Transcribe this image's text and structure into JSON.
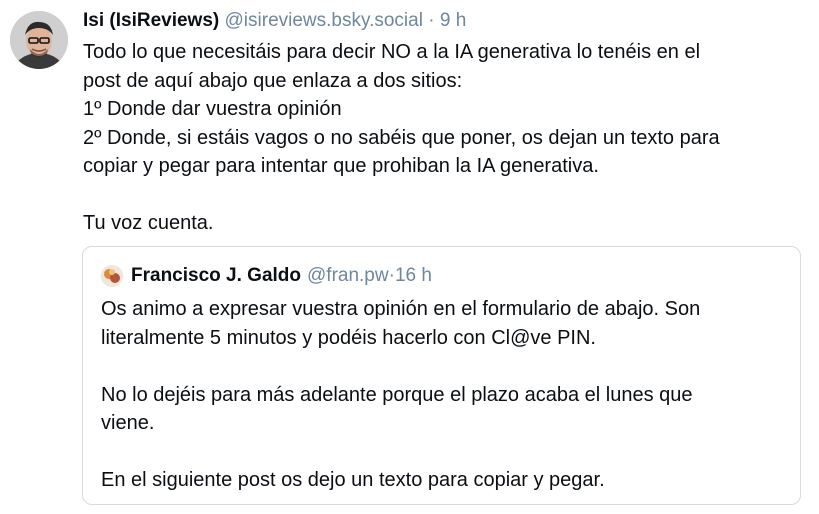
{
  "post": {
    "author_name": "Isi (IsiReviews)",
    "author_handle": "@isireviews.bsky.social",
    "separator": "·",
    "time_ago": "9 h",
    "lines": [
      "Todo lo que necesitáis para decir NO a la IA generativa lo tenéis en el",
      "post de aquí abajo que enlaza a dos sitios:",
      "1º Donde dar vuestra opinión",
      "2º Donde, si estáis vagos o no sabéis que poner, os dejan un texto para",
      "copiar y pegar para intentar que prohiban la IA generativa.",
      "",
      "Tu voz cuenta."
    ]
  },
  "quote": {
    "author_name": "Francisco J. Galdo",
    "author_handle": "@fran.pw",
    "separator": "·",
    "time_ago": "16 h",
    "lines": [
      "Os animo a expresar vuestra opinión en el formulario de abajo. Son",
      "literalmente 5 minutos y podéis hacerlo con Cl@ve PIN.",
      "",
      "No lo dejéis para más adelante porque el plazo acaba el lunes que",
      "viene.",
      "",
      "En el siguiente post os dejo un texto para copiar y pegar."
    ]
  },
  "colors": {
    "text": "#0b0f14",
    "muted": "#6f869f",
    "border": "#d4dbe2"
  }
}
